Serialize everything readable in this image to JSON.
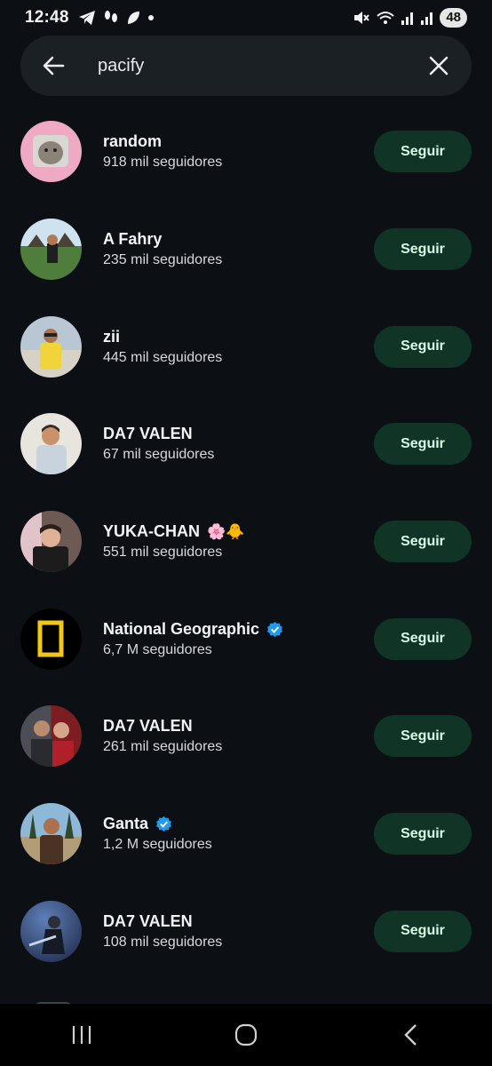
{
  "status_bar": {
    "time": "12:48",
    "battery": "48"
  },
  "search": {
    "query": "pacify"
  },
  "follow_label": "Seguir",
  "results": [
    {
      "name": "random",
      "followers": "918 mil seguidores",
      "verified": false,
      "emoji": ""
    },
    {
      "name": "A Fahry",
      "followers": "235 mil seguidores",
      "verified": false,
      "emoji": ""
    },
    {
      "name": "zii",
      "followers": "445 mil seguidores",
      "verified": false,
      "emoji": ""
    },
    {
      "name": "DA7 VALEN",
      "followers": "67 mil seguidores",
      "verified": false,
      "emoji": ""
    },
    {
      "name": "YUKA-CHAN",
      "followers": "551 mil seguidores",
      "verified": false,
      "emoji": "🌸🐥"
    },
    {
      "name": "National Geographic",
      "followers": "6,7 M seguidores",
      "verified": true,
      "emoji": ""
    },
    {
      "name": "DA7 VALEN",
      "followers": "261 mil seguidores",
      "verified": false,
      "emoji": ""
    },
    {
      "name": "Ganta",
      "followers": "1,2 M seguidores",
      "verified": true,
      "emoji": ""
    },
    {
      "name": "DA7 VALEN",
      "followers": "108 mil seguidores",
      "verified": false,
      "emoji": ""
    }
  ],
  "colors": {
    "background": "#0c1014",
    "search_bg": "#1b2025",
    "button_bg": "#103527",
    "button_text": "#d8fbe6",
    "verified": "#1d9bf0"
  }
}
